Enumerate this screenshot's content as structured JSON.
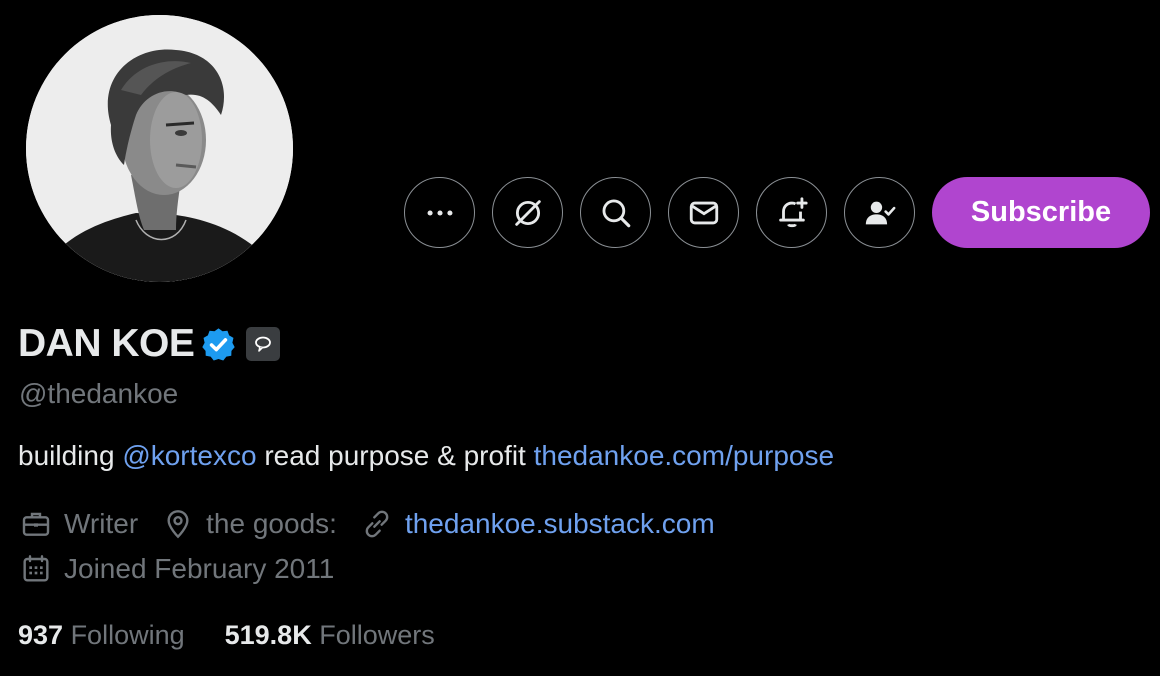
{
  "profile": {
    "name": "DAN KOE",
    "handle": "@thedankoe",
    "bio": {
      "prefix": "building ",
      "mention": "@kortexco",
      "middle": " read purpose & profit ",
      "link": "thedankoe.com/purpose"
    },
    "meta": {
      "profession": "Writer",
      "location": "the goods:",
      "website": "thedankoe.substack.com",
      "joined": "Joined February 2011"
    },
    "stats": {
      "following_count": "937",
      "following_label": " Following",
      "followers_count": "519.8K",
      "followers_label": " Followers"
    }
  },
  "actions": {
    "more_icon": "more-icon",
    "grok_icon": "grok-icon",
    "search_icon": "search-icon",
    "message_icon": "mail-icon",
    "notify_icon": "bell-plus-icon",
    "following_icon": "person-check-icon",
    "subscribe_label": "Subscribe"
  },
  "colors": {
    "background": "#000000",
    "text_primary": "#e7e9ea",
    "text_secondary": "#71767b",
    "link": "#6fa1ef",
    "subscribe": "#b045cf",
    "verified": "#1d9bf0"
  }
}
